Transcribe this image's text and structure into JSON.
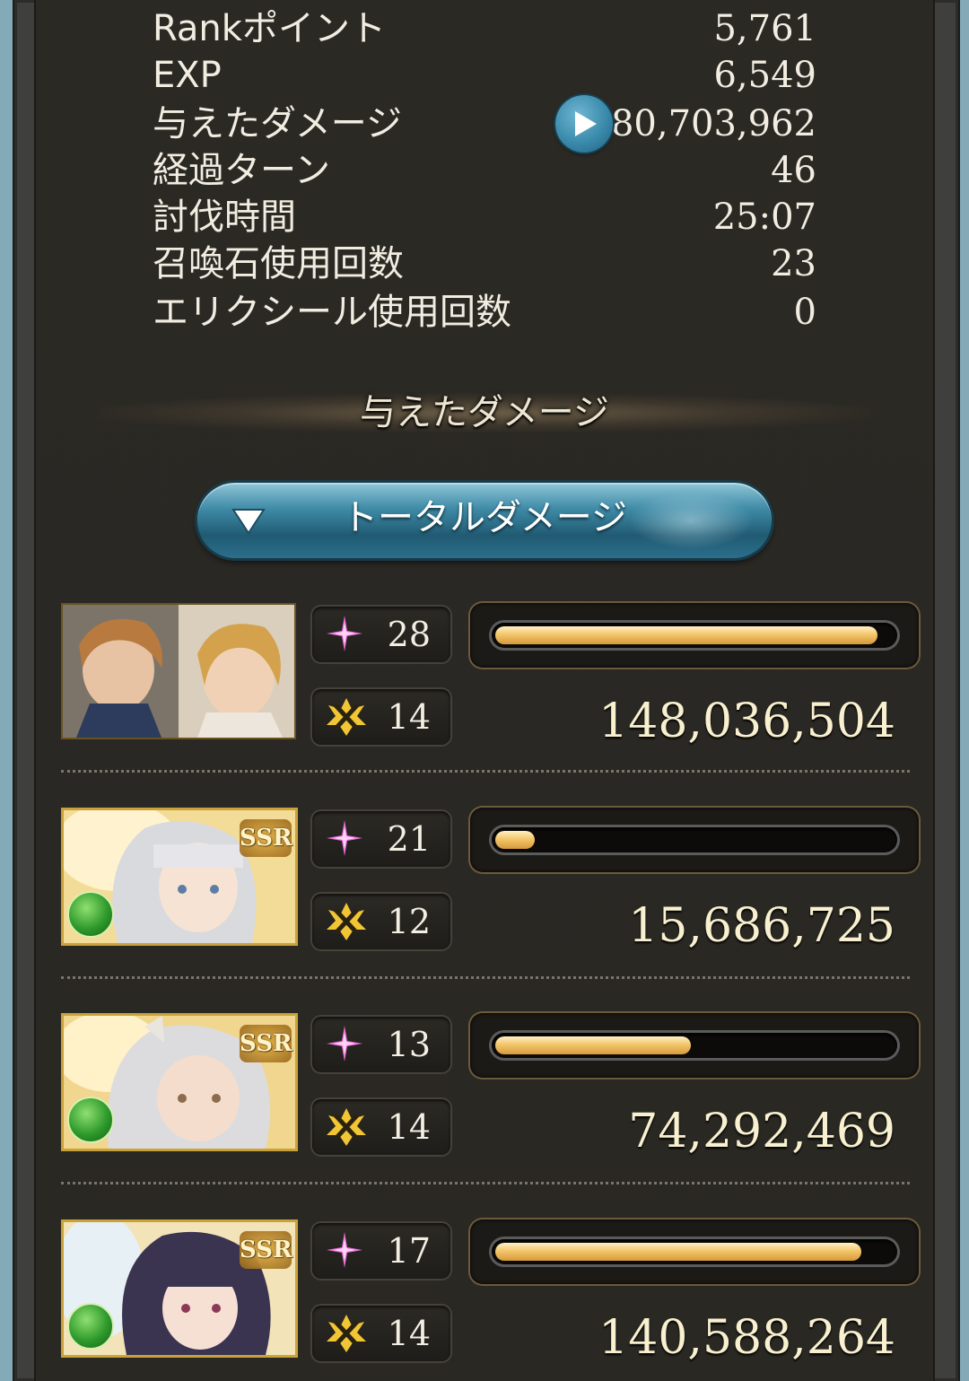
{
  "stats": [
    {
      "label": "Rankポイント",
      "value": "5,761"
    },
    {
      "label": "EXP",
      "value": "6,549"
    },
    {
      "label": "与えたダメージ",
      "value": "380,703,962"
    },
    {
      "label": "経過ターン",
      "value": "46"
    },
    {
      "label": "討伐時間",
      "value": "25:07"
    },
    {
      "label": "召喚石使用回数",
      "value": "23"
    },
    {
      "label": "エリクシール使用回数",
      "value": "0"
    }
  ],
  "section": {
    "title": "与えたダメージ"
  },
  "dropdown": {
    "label": "トータルダメージ",
    "icon": "triangle-down-icon"
  },
  "icons": {
    "play": "play-icon",
    "skill": "sparkle-icon",
    "attack": "crossed-swords-icon",
    "element": "wind-element-icon"
  },
  "colors": {
    "accent_blue": "#3e8aa6",
    "bar_gold": "#f3c66a",
    "text": "#f1ede1"
  },
  "party": [
    {
      "name_tag": "main-character",
      "rarity": "",
      "skill_count": "28",
      "attack_count": "14",
      "damage": "148,036,504",
      "damage_ratio": 0.96
    },
    {
      "name_tag": "member-2",
      "rarity": "SSR",
      "skill_count": "21",
      "attack_count": "12",
      "damage": "15,686,725",
      "damage_ratio": 0.1
    },
    {
      "name_tag": "member-3",
      "rarity": "SSR",
      "skill_count": "13",
      "attack_count": "14",
      "damage": "74,292,469",
      "damage_ratio": 0.49
    },
    {
      "name_tag": "member-4",
      "rarity": "SSR",
      "skill_count": "17",
      "attack_count": "14",
      "damage": "140,588,264",
      "damage_ratio": 0.92
    }
  ]
}
